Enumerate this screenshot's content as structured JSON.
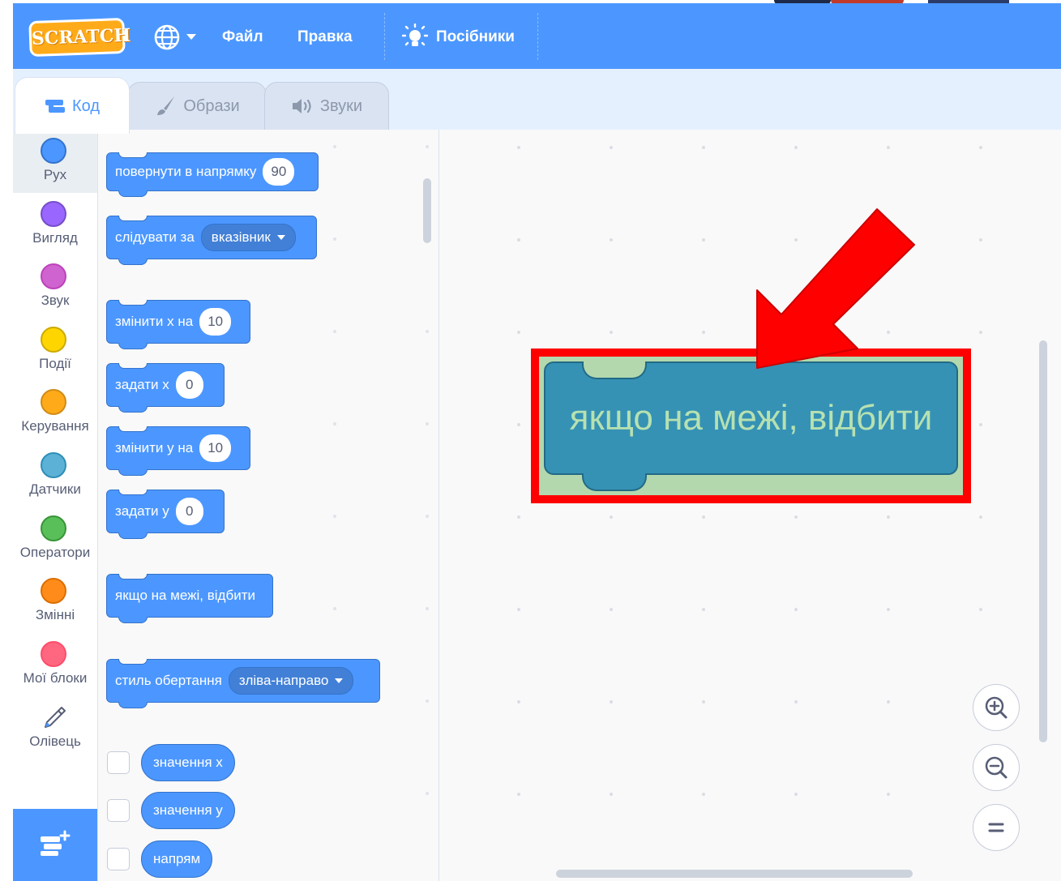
{
  "menu": {
    "logo": "SCRATCH",
    "language_icon": "globe-icon",
    "file": "Файл",
    "edit": "Правка",
    "tutorials": "Посібники",
    "tutorials_icon": "lightbulb-icon"
  },
  "tabs": [
    {
      "label": "Код",
      "icon": "code-icon",
      "active": true
    },
    {
      "label": "Образи",
      "icon": "brush-icon",
      "active": false
    },
    {
      "label": "Звуки",
      "icon": "speaker-icon",
      "active": false
    }
  ],
  "categories": [
    {
      "label": "Рух",
      "color": "#4c97ff",
      "selected": true
    },
    {
      "label": "Вигляд",
      "color": "#9966ff"
    },
    {
      "label": "Звук",
      "color": "#cf63cf"
    },
    {
      "label": "Події",
      "color": "#ffd500"
    },
    {
      "label": "Керування",
      "color": "#ffab19"
    },
    {
      "label": "Датчики",
      "color": "#5cb1d6"
    },
    {
      "label": "Оператори",
      "color": "#59c059"
    },
    {
      "label": "Змінні",
      "color": "#ff8c1a"
    },
    {
      "label": "Мої блоки",
      "color": "#ff6680"
    },
    {
      "label": "Олівець",
      "icon": "pen-icon"
    }
  ],
  "blocks": {
    "point_direction": {
      "label": "повернути в напрямку",
      "value": "90"
    },
    "point_towards": {
      "label": "слідувати за",
      "option": "вказівник"
    },
    "change_x": {
      "label": "змінити х на",
      "value": "10"
    },
    "set_x": {
      "label": "задати х",
      "value": "0"
    },
    "change_y": {
      "label": "змінити у на",
      "value": "10"
    },
    "set_y": {
      "label": "задати у",
      "value": "0"
    },
    "bounce": {
      "label": "якщо на межі, відбити"
    },
    "rotation_style": {
      "label": "стиль обертання",
      "option": "зліва-направо"
    },
    "x_position": {
      "label": "значення х"
    },
    "y_position": {
      "label": "значення у"
    },
    "direction": {
      "label": "напрям"
    }
  },
  "workspace": {
    "highlighted_block": "якщо на межі, відбити",
    "highlight_color": "#ff0000",
    "zoom_in_icon": "zoom-in-icon",
    "zoom_out_icon": "zoom-out-icon",
    "zoom_reset_icon": "zoom-reset-icon"
  }
}
